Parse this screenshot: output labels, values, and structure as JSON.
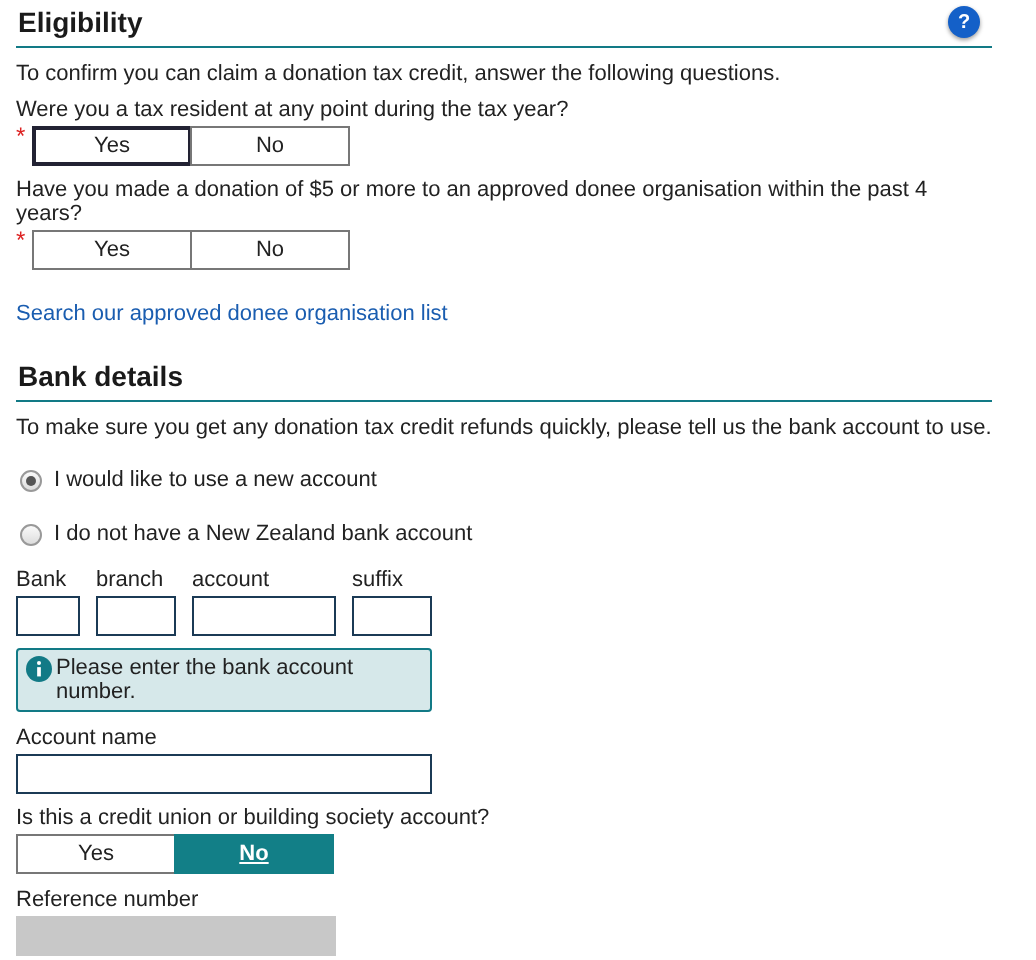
{
  "eligibility": {
    "title": "Eligibility",
    "help": "?",
    "intro": "To confirm you can claim a donation tax credit, answer the following questions.",
    "questions": [
      {
        "label": "Were you a tax resident at any point during the tax year?",
        "required_mark": "*",
        "options": [
          {
            "label": "Yes",
            "selected": false,
            "focused": true
          },
          {
            "label": "No",
            "selected": false,
            "focused": false
          }
        ]
      },
      {
        "label": "Have you made a donation of $5 or more to an approved donee organisation within the past 4 years?",
        "required_mark": "*",
        "options": [
          {
            "label": "Yes",
            "selected": false,
            "focused": false
          },
          {
            "label": "No",
            "selected": false,
            "focused": false
          }
        ]
      }
    ],
    "link": "Search our approved donee organisation list"
  },
  "bank": {
    "title": "Bank details",
    "intro": "To make sure you get any donation tax credit refunds quickly, please tell us the bank account to use.",
    "radios": [
      {
        "label": "I would like to use a new account",
        "selected": true
      },
      {
        "label": "I do not have a New Zealand bank account",
        "selected": false
      }
    ],
    "account_fields": [
      {
        "label": "Bank",
        "kind": "short"
      },
      {
        "label": "branch",
        "kind": "medium"
      },
      {
        "label": "account",
        "kind": "long"
      },
      {
        "label": "suffix",
        "kind": "medium"
      }
    ],
    "info": "Please enter the bank account number.",
    "account_name": {
      "label": "Account name"
    },
    "credit_union": {
      "label": "Is this a credit union or building society account?",
      "options": [
        {
          "label": "Yes",
          "selected": false,
          "focused": false
        },
        {
          "label": "No",
          "selected": true,
          "focused": false
        }
      ]
    },
    "reference": {
      "label": "Reference number",
      "disabled": true
    }
  }
}
